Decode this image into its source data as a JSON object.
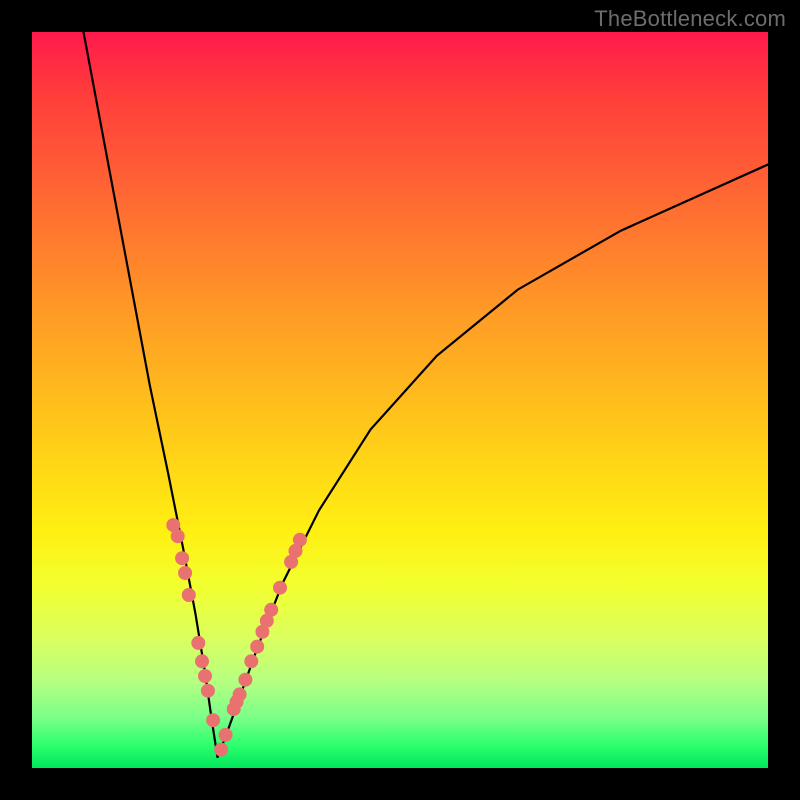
{
  "watermark": "TheBottleneck.com",
  "colors": {
    "frame": "#000000",
    "gradient_top": "#ff1a4d",
    "gradient_mid": "#ffd416",
    "gradient_bottom": "#00e65c",
    "curve": "#000000",
    "dots": "#e9716f"
  },
  "chart_data": {
    "type": "line",
    "title": "",
    "xlabel": "",
    "ylabel": "",
    "xlim": [
      0,
      100
    ],
    "ylim": [
      0,
      100
    ],
    "description": "V-shaped bottleneck curve over a red→yellow→green vertical gradient. Minimum near x≈25, y≈0. Left branch rises steeply to y≈100 at x≈7; right branch rises with decreasing slope to y≈82 at x≈100.",
    "series": [
      {
        "name": "curve-left",
        "x": [
          7.0,
          10.0,
          13.0,
          16.0,
          18.5,
          20.5,
          22.2,
          23.5,
          24.5,
          25.2
        ],
        "y": [
          100,
          84,
          68,
          52,
          40,
          30,
          21,
          13,
          6,
          1.5
        ]
      },
      {
        "name": "curve-right",
        "x": [
          25.2,
          26.2,
          28.0,
          30.5,
          34.0,
          39.0,
          46.0,
          55.0,
          66.0,
          80.0,
          100.0
        ],
        "y": [
          1.5,
          4,
          9,
          16,
          25,
          35,
          46,
          56,
          65,
          73,
          82
        ]
      }
    ],
    "scatter": {
      "name": "highlight-dots",
      "points": [
        {
          "x": 19.2,
          "y": 33.0
        },
        {
          "x": 19.8,
          "y": 31.5
        },
        {
          "x": 20.4,
          "y": 28.5
        },
        {
          "x": 20.8,
          "y": 26.5
        },
        {
          "x": 21.3,
          "y": 23.5
        },
        {
          "x": 22.6,
          "y": 17.0
        },
        {
          "x": 23.1,
          "y": 14.5
        },
        {
          "x": 23.5,
          "y": 12.5
        },
        {
          "x": 23.9,
          "y": 10.5
        },
        {
          "x": 24.6,
          "y": 6.5
        },
        {
          "x": 25.7,
          "y": 2.5
        },
        {
          "x": 26.3,
          "y": 4.5
        },
        {
          "x": 27.4,
          "y": 8.0
        },
        {
          "x": 27.8,
          "y": 9.0
        },
        {
          "x": 28.2,
          "y": 10.0
        },
        {
          "x": 29.0,
          "y": 12.0
        },
        {
          "x": 29.8,
          "y": 14.5
        },
        {
          "x": 30.6,
          "y": 16.5
        },
        {
          "x": 31.3,
          "y": 18.5
        },
        {
          "x": 31.9,
          "y": 20.0
        },
        {
          "x": 32.5,
          "y": 21.5
        },
        {
          "x": 33.7,
          "y": 24.5
        },
        {
          "x": 35.2,
          "y": 28.0
        },
        {
          "x": 35.8,
          "y": 29.5
        },
        {
          "x": 36.4,
          "y": 31.0
        }
      ]
    }
  }
}
